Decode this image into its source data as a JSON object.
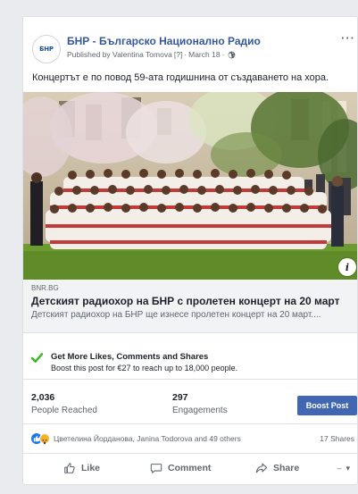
{
  "post": {
    "page_name": "БНР - Българско Национално Радио",
    "published_by": "Published by Valentina Tomova",
    "published_marker": "[?]",
    "date": "March 18",
    "text": "Концертът е по повод 59-ата годишнина от създаването на хора.",
    "avatar_text": "БНР",
    "more_label": "···"
  },
  "link": {
    "domain": "BNR.BG",
    "title": "Детският радиохор на БНР с пролетен концерт на 20 март",
    "description": "Детският радиохор на БНР ще изнесе пролетен концерт на 20 март...."
  },
  "promotion": {
    "title": "Get More Likes, Comments and Shares",
    "subtitle": "Boost this post for €27 to reach up to 18,000 people."
  },
  "stats": {
    "reached_value": "2,036",
    "reached_label": "People Reached",
    "engagements_value": "297",
    "engagements_label": "Engagements",
    "boost_label": "Boost Post"
  },
  "reactions": {
    "names": "Цветелина Йорданова, Janina Todorova and 49 others",
    "shares": "17 Shares"
  },
  "actions": {
    "like": "Like",
    "comment": "Comment",
    "share": "Share"
  },
  "colors": {
    "link_blue": "#365899",
    "boost_blue": "#4267b2",
    "check_green": "#42b72a"
  },
  "icons": [
    "globe-icon",
    "more-icon",
    "info-icon",
    "check-icon",
    "like-reaction-icon",
    "wow-reaction-icon",
    "like-icon",
    "comment-icon",
    "share-icon",
    "dropdown-icon"
  ]
}
